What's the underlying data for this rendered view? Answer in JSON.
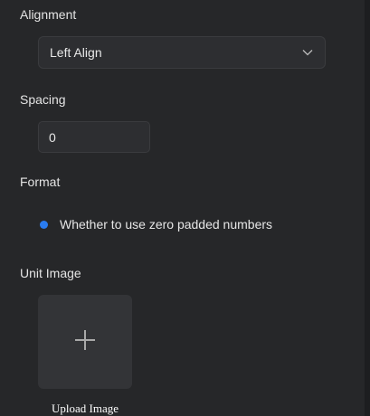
{
  "alignment": {
    "label": "Alignment",
    "selected": "Left Align"
  },
  "spacing": {
    "label": "Spacing",
    "value": "0"
  },
  "format": {
    "label": "Format",
    "option": "Whether to use zero padded numbers",
    "accent": "#2a7cf0"
  },
  "unit_image": {
    "label": "Unit Image",
    "upload_caption": "Upload Image",
    "icon": "plus-icon"
  }
}
